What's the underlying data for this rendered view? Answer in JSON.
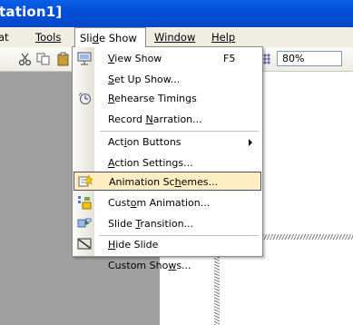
{
  "window": {
    "title": "tation1]"
  },
  "menubar": {
    "items": [
      {
        "label": "at",
        "accel_index": -1
      },
      {
        "label": "Tools",
        "accel_index": 0
      },
      {
        "label": "Slide Show",
        "accel_index": 3
      },
      {
        "label": "Window",
        "accel_index": 0
      },
      {
        "label": "Help",
        "accel_index": 0
      }
    ],
    "active": "Slide Show"
  },
  "toolbar": {
    "zoom": "80%",
    "icons": [
      "cut-icon",
      "copy-icon",
      "paste-icon",
      "slide-show-icon",
      "chart-icon",
      "grid-icon"
    ]
  },
  "slide_show_menu": {
    "items": [
      {
        "pre": "",
        "u": "V",
        "post": "iew Show",
        "shortcut": "F5",
        "icon": "view-show-icon"
      },
      {
        "pre": "",
        "u": "S",
        "post": "et Up Show...",
        "icon": ""
      },
      {
        "pre": "",
        "u": "R",
        "post": "ehearse Timings",
        "icon": "rehearse-timings-icon"
      },
      {
        "pre": "Record ",
        "u": "N",
        "post": "arration...",
        "icon": ""
      },
      {
        "pre": "Act",
        "u": "i",
        "post": "on Buttons",
        "submenu": true,
        "icon": ""
      },
      {
        "pre": "",
        "u": "A",
        "post": "ction Settings...",
        "icon": ""
      },
      {
        "pre": "Animation Sc",
        "u": "h",
        "post": "emes...",
        "highlighted": true,
        "icon": "animation-schemes-icon"
      },
      {
        "pre": "Cust",
        "u": "o",
        "post": "m Animation...",
        "icon": "custom-animation-icon"
      },
      {
        "pre": "Slide ",
        "u": "T",
        "post": "ransition...",
        "icon": "slide-transition-icon"
      },
      {
        "pre": "",
        "u": "H",
        "post": "ide Slide",
        "icon": "hide-slide-icon"
      },
      {
        "pre": "Custom Sho",
        "u": "w",
        "post": "s...",
        "icon": ""
      }
    ]
  },
  "colors": {
    "titlebar": "#0450d8",
    "menubar": "#f0ede3",
    "highlight": "#ffeec2",
    "highlight_border": "#4b4b6f",
    "workspace": "#a0a0a0"
  }
}
